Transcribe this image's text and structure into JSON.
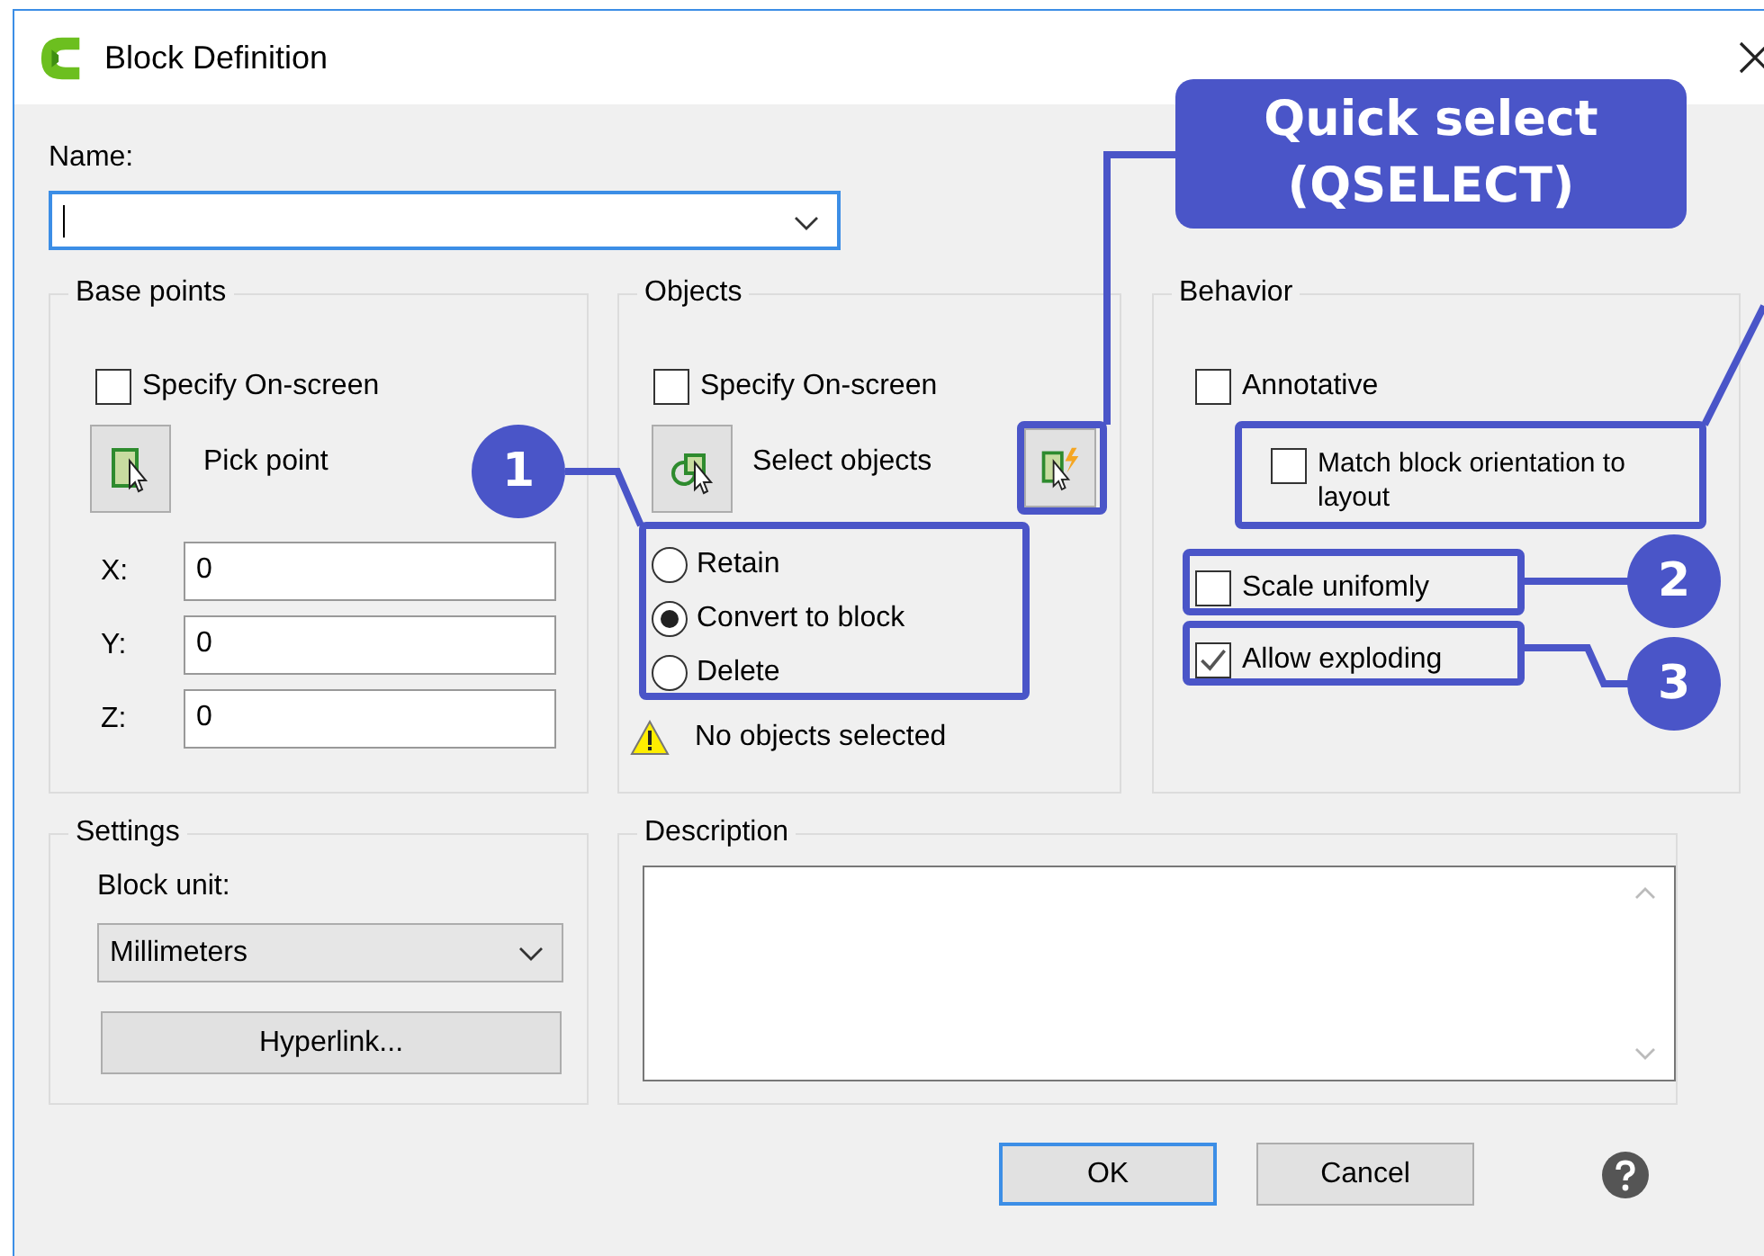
{
  "window": {
    "title": "Block Definition"
  },
  "name": {
    "label": "Name:"
  },
  "base_points": {
    "title": "Base points",
    "specify": {
      "label": "Specify On-screen",
      "checked": false
    },
    "pick_label": "Pick point",
    "coords": [
      {
        "label": "X:",
        "value": "0"
      },
      {
        "label": "Y:",
        "value": "0"
      },
      {
        "label": "Z:",
        "value": "0"
      }
    ]
  },
  "objects": {
    "title": "Objects",
    "specify": {
      "label": "Specify On-screen",
      "checked": false
    },
    "select_label": "Select objects",
    "options": [
      {
        "label": "Retain",
        "selected": false
      },
      {
        "label": "Convert to block",
        "selected": true
      },
      {
        "label": "Delete",
        "selected": false
      }
    ],
    "warning": "No objects selected"
  },
  "behavior": {
    "title": "Behavior",
    "options": [
      {
        "label": "Annotative",
        "checked": false,
        "children": [
          {
            "label": "Match block orientation to layout",
            "checked": false
          }
        ]
      },
      {
        "label": "Scale unifomly",
        "checked": false
      },
      {
        "label": "Allow exploding",
        "checked": true
      }
    ]
  },
  "settings": {
    "title": "Settings",
    "unit_label": "Block unit:",
    "unit_value": "Millimeters",
    "hyperlink": "Hyperlink..."
  },
  "description": {
    "title": "Description"
  },
  "buttons": [
    {
      "label": "OK",
      "default": true
    },
    {
      "label": "Cancel",
      "default": false
    }
  ],
  "annotations": {
    "label": "Quick select (QSELECT)",
    "callouts": [
      {
        "number": "1"
      },
      {
        "number": "2"
      },
      {
        "number": "3"
      }
    ]
  }
}
